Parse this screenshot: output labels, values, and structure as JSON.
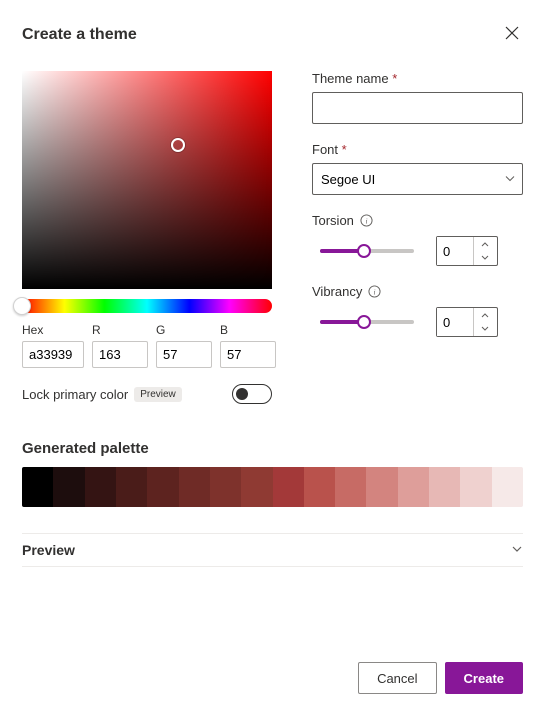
{
  "title": "Create a theme",
  "labels": {
    "theme_name": "Theme name",
    "font": "Font",
    "torsion": "Torsion",
    "vibrancy": "Vibrancy",
    "hex": "Hex",
    "r": "R",
    "g": "G",
    "b": "B",
    "lock_primary": "Lock primary color",
    "preview_badge": "Preview",
    "generated_palette": "Generated palette",
    "preview": "Preview"
  },
  "required_marker": "*",
  "theme_name_value": "",
  "font_value": "Segoe UI",
  "torsion_value": "0",
  "vibrancy_value": "0",
  "color": {
    "hex": "a33939",
    "r": "163",
    "g": "57",
    "b": "57"
  },
  "lock_primary_on": false,
  "palette_colors": [
    "#000000",
    "#1d0d0d",
    "#341413",
    "#4a1c19",
    "#5d231f",
    "#6f2b26",
    "#7e322c",
    "#8f3a33",
    "#a33939",
    "#b9524c",
    "#c76b65",
    "#d3847f",
    "#de9e9a",
    "#e7b8b5",
    "#efd1cf",
    "#f6e9e8"
  ],
  "buttons": {
    "cancel": "Cancel",
    "create": "Create"
  },
  "accent_color": "#881798"
}
